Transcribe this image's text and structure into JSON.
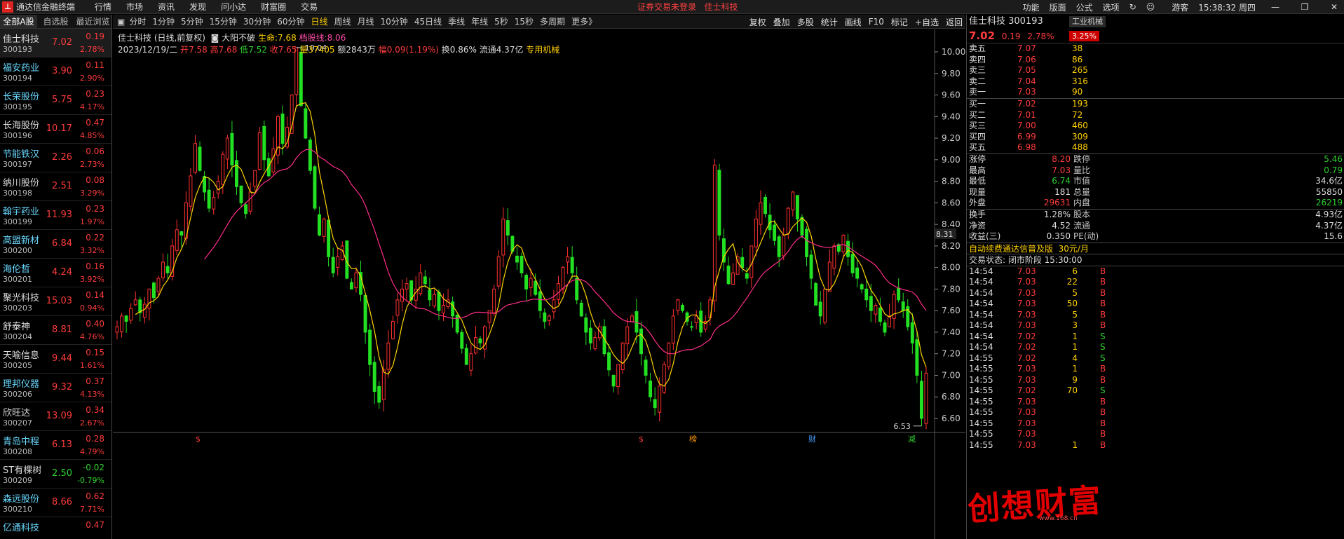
{
  "app": {
    "title": "通达信金融终端",
    "menus": [
      "行情",
      "市场",
      "资讯",
      "发现",
      "问小达",
      "财富圈",
      "交易"
    ],
    "notice": "证券交易未登录",
    "notice_stock": "佳士科技",
    "right_menus": [
      "功能",
      "版面",
      "公式",
      "选项"
    ],
    "user": "游客",
    "clock": "15:38:32 周四"
  },
  "list": {
    "tabs": [
      "全部A股",
      "自选股",
      "最近浏览"
    ],
    "rows": [
      {
        "name": "佳士科技",
        "code": "300193",
        "price": "7.02",
        "chg": "0.19",
        "pct": "2.78%",
        "nc": "w",
        "dir": "up",
        "sel": true
      },
      {
        "name": "福安药业",
        "code": "300194",
        "price": "3.90",
        "chg": "0.11",
        "pct": "2.90%",
        "nc": "c",
        "dir": "up"
      },
      {
        "name": "长荣股份",
        "code": "300195",
        "price": "5.75",
        "chg": "0.23",
        "pct": "4.17%",
        "nc": "c",
        "dir": "up"
      },
      {
        "name": "长海股份",
        "code": "300196",
        "price": "10.17",
        "chg": "0.47",
        "pct": "4.85%",
        "nc": "w",
        "dir": "up"
      },
      {
        "name": "节能铁汉",
        "code": "300197",
        "price": "2.26",
        "chg": "0.06",
        "pct": "2.73%",
        "nc": "c",
        "dir": "up"
      },
      {
        "name": "纳川股份",
        "code": "300198",
        "price": "2.51",
        "chg": "0.08",
        "pct": "3.29%",
        "nc": "w",
        "dir": "up"
      },
      {
        "name": "翰宇药业",
        "code": "300199",
        "price": "11.93",
        "chg": "0.23",
        "pct": "1.97%",
        "nc": "c",
        "dir": "up"
      },
      {
        "name": "高盟新材",
        "code": "300200",
        "price": "6.84",
        "chg": "0.22",
        "pct": "3.32%",
        "nc": "c",
        "dir": "up"
      },
      {
        "name": "海伦哲",
        "code": "300201",
        "price": "4.24",
        "chg": "0.16",
        "pct": "3.92%",
        "nc": "c",
        "dir": "up"
      },
      {
        "name": "聚光科技",
        "code": "300203",
        "price": "15.03",
        "chg": "0.14",
        "pct": "0.94%",
        "nc": "w",
        "dir": "up"
      },
      {
        "name": "舒泰神",
        "code": "300204",
        "price": "8.81",
        "chg": "0.40",
        "pct": "4.76%",
        "nc": "w",
        "dir": "up"
      },
      {
        "name": "天喻信息",
        "code": "300205",
        "price": "9.44",
        "chg": "0.15",
        "pct": "1.61%",
        "nc": "w",
        "dir": "up"
      },
      {
        "name": "理邦仪器",
        "code": "300206",
        "price": "9.32",
        "chg": "0.37",
        "pct": "4.13%",
        "nc": "c",
        "dir": "up"
      },
      {
        "name": "欣旺达",
        "code": "300207",
        "price": "13.09",
        "chg": "0.34",
        "pct": "2.67%",
        "nc": "w",
        "dir": "up"
      },
      {
        "name": "青岛中程",
        "code": "300208",
        "price": "6.13",
        "chg": "0.28",
        "pct": "4.79%",
        "nc": "c",
        "dir": "up"
      },
      {
        "name": "ST有棵树",
        "code": "300209",
        "price": "2.50",
        "chg": "-0.02",
        "pct": "-0.79%",
        "nc": "w",
        "dir": "down"
      },
      {
        "name": "森远股份",
        "code": "300210",
        "price": "8.66",
        "chg": "0.62",
        "pct": "7.71%",
        "nc": "c",
        "dir": "up"
      },
      {
        "name": "亿通科技",
        "code": "",
        "price": "",
        "chg": "0.47",
        "pct": "",
        "nc": "c",
        "dir": "up"
      }
    ]
  },
  "periods": {
    "items": [
      "分时",
      "1分钟",
      "5分钟",
      "15分钟",
      "30分钟",
      "60分钟",
      "日线",
      "周线",
      "月线",
      "10分钟",
      "45日线",
      "季线",
      "年线",
      "5秒",
      "15秒",
      "多周期",
      "更多》"
    ],
    "active": "日线",
    "tools": [
      "复权",
      "叠加",
      "多股",
      "统计",
      "画线",
      "F10",
      "标记",
      "+自选",
      "返回"
    ]
  },
  "chart": {
    "title": "佳士科技 (日线,前复权)",
    "pattern": "大阳不破",
    "life_label": "生命:",
    "life_val": "7.68",
    "line_label": "档股线:",
    "line_val": "8.06",
    "date": "2023/12/19/二",
    "open_l": "开",
    "open": "7.58",
    "high_l": "高",
    "high": "7.68",
    "low_l": "低",
    "low": "7.52",
    "close_l": "收",
    "close": "7.65",
    "vol_l": "量",
    "vol": "37405",
    "amt_l": "额",
    "amt": "2843万",
    "amp_l": "幅",
    "amp": "0.09(1.19%)",
    "turn": "换0.86%",
    "float": "流通4.37亿",
    "sector": "专用机械",
    "max_label": "10.04",
    "min_label": "6.53",
    "cursor_price": "8.31",
    "y_ticks": [
      "10.00",
      "9.80",
      "9.60",
      "9.40",
      "9.20",
      "9.00",
      "8.80",
      "8.60",
      "8.40",
      "8.20",
      "8.00",
      "7.80",
      "7.60",
      "7.40",
      "7.20",
      "7.00",
      "6.80",
      "6.60"
    ],
    "markers": [
      {
        "t": "$",
        "c": "#ff3c3c"
      },
      {
        "t": "$",
        "c": "#ff3c3c"
      },
      {
        "t": "榜",
        "c": "#ff9a00"
      },
      {
        "t": "财",
        "c": "#4aa0ff"
      },
      {
        "t": "减",
        "c": "#2fd12f"
      }
    ]
  },
  "chart_data": {
    "type": "candlestick",
    "title": "佳士科技 (日线,前复权)",
    "ylim": [
      6.5,
      10.1
    ],
    "y_ticks": [
      10.0,
      9.8,
      9.6,
      9.4,
      9.2,
      9.0,
      8.8,
      8.6,
      8.4,
      8.2,
      8.0,
      7.8,
      7.6,
      7.4,
      7.2,
      7.0,
      6.8,
      6.6
    ],
    "high_mark": 10.04,
    "low_mark": 6.53,
    "last_close": 7.02,
    "close_series": [
      7.45,
      7.55,
      7.5,
      7.62,
      7.7,
      7.58,
      7.66,
      7.8,
      7.72,
      7.9,
      8.05,
      7.95,
      8.2,
      8.35,
      8.3,
      8.6,
      8.85,
      9.15,
      8.9,
      8.7,
      8.55,
      8.65,
      8.8,
      9.05,
      9.2,
      8.95,
      8.75,
      8.6,
      8.5,
      8.7,
      8.9,
      9.25,
      9.0,
      8.85,
      9.1,
      9.4,
      9.15,
      9.3,
      9.6,
      10.04,
      9.5,
      9.2,
      8.9,
      8.55,
      8.3,
      8.45,
      8.1,
      7.95,
      8.1,
      8.2,
      7.9,
      7.8,
      7.95,
      7.75,
      7.4,
      7.1,
      6.85,
      6.75,
      7.05,
      7.3,
      7.5,
      7.7,
      7.8,
      7.85,
      7.7,
      7.8,
      7.95,
      7.85,
      7.7,
      7.75,
      7.6,
      7.65,
      7.7,
      7.55,
      7.4,
      7.25,
      7.1,
      7.2,
      7.35,
      7.3,
      7.45,
      7.6,
      7.8,
      8.1,
      8.45,
      8.3,
      8.15,
      8.05,
      7.95,
      7.8,
      7.9,
      7.75,
      7.6,
      7.5,
      7.55,
      7.7,
      7.85,
      8.0,
      8.1,
      7.95,
      7.7,
      7.55,
      7.4,
      7.3,
      7.35,
      7.45,
      7.2,
      7.05,
      6.9,
      7.1,
      7.3,
      7.45,
      7.55,
      7.4,
      7.2,
      7.0,
      6.8,
      6.7,
      6.9,
      7.1,
      7.3,
      7.55,
      7.7,
      7.6,
      7.5,
      7.45,
      7.55,
      7.4,
      7.5,
      7.7,
      8.95,
      8.3,
      8.05,
      7.85,
      7.95,
      8.1,
      8.0,
      7.9,
      8.2,
      8.45,
      8.6,
      8.5,
      8.35,
      8.25,
      8.1,
      8.3,
      8.55,
      8.7,
      8.45,
      8.3,
      8.1,
      7.9,
      7.65,
      7.55,
      7.8,
      8.05,
      8.2,
      8.15,
      8.3,
      8.1,
      7.95,
      7.9,
      7.8,
      7.7,
      7.6,
      7.65,
      7.5,
      7.4,
      7.55,
      7.75,
      7.7,
      7.6,
      7.45,
      7.3,
      7.0,
      6.6,
      7.02
    ]
  },
  "quote": {
    "name_code": "佳士科技 300193",
    "sector": "工业机械",
    "price": "7.02",
    "chg": "0.19",
    "pct": "2.78%",
    "sector_pct": "3.25%",
    "asks": [
      {
        "l": "卖五",
        "p": "7.07",
        "v": "38"
      },
      {
        "l": "卖四",
        "p": "7.06",
        "v": "86"
      },
      {
        "l": "卖三",
        "p": "7.05",
        "v": "265"
      },
      {
        "l": "卖二",
        "p": "7.04",
        "v": "316"
      },
      {
        "l": "卖一",
        "p": "7.03",
        "v": "90"
      }
    ],
    "bids": [
      {
        "l": "买一",
        "p": "7.02",
        "v": "193"
      },
      {
        "l": "买二",
        "p": "7.01",
        "v": "72"
      },
      {
        "l": "买三",
        "p": "7.00",
        "v": "460"
      },
      {
        "l": "买四",
        "p": "6.99",
        "v": "309"
      },
      {
        "l": "买五",
        "p": "6.98",
        "v": "488"
      }
    ],
    "stats1": [
      {
        "a": "涨停",
        "b": "8.20",
        "bc": "red",
        "c": "跌停",
        "d": "5.46",
        "dc": "grn"
      },
      {
        "a": "最高",
        "b": "7.03",
        "bc": "red",
        "c": "量比",
        "d": "0.79",
        "dc": "grn"
      },
      {
        "a": "最低",
        "b": "6.74",
        "bc": "grn",
        "c": "市值",
        "d": "34.6亿",
        "dc": "wht"
      },
      {
        "a": "现量",
        "b": "181",
        "bc": "wht",
        "c": "总量",
        "d": "55850",
        "dc": "wht"
      },
      {
        "a": "外盘",
        "b": "29631",
        "bc": "red",
        "c": "内盘",
        "d": "26219",
        "dc": "grn"
      }
    ],
    "stats2": [
      {
        "a": "换手",
        "b": "1.28%",
        "bc": "wht",
        "c": "股本",
        "d": "4.93亿",
        "dc": "wht"
      },
      {
        "a": "净资",
        "b": "4.52",
        "bc": "wht",
        "c": "流通",
        "d": "4.37亿",
        "dc": "wht"
      },
      {
        "a": "收益(三)",
        "b": "0.350",
        "bc": "wht",
        "c": "PE(动)",
        "d": "15.6",
        "dc": "wht"
      }
    ],
    "banner": "自动续费通达信普及版",
    "banner_price": "30元/月",
    "trade_status": "交易状态: 闭市阶段 15:30:00",
    "trades": [
      {
        "t": "14:54",
        "p": "7.03",
        "v": "6",
        "s": "B"
      },
      {
        "t": "14:54",
        "p": "7.03",
        "v": "22",
        "s": "B"
      },
      {
        "t": "14:54",
        "p": "7.03",
        "v": "5",
        "s": "B"
      },
      {
        "t": "14:54",
        "p": "7.03",
        "v": "50",
        "s": "B"
      },
      {
        "t": "14:54",
        "p": "7.03",
        "v": "5",
        "s": "B"
      },
      {
        "t": "14:54",
        "p": "7.03",
        "v": "3",
        "s": "B"
      },
      {
        "t": "14:54",
        "p": "7.02",
        "v": "1",
        "s": "S"
      },
      {
        "t": "14:54",
        "p": "7.02",
        "v": "1",
        "s": "S"
      },
      {
        "t": "14:55",
        "p": "7.02",
        "v": "4",
        "s": "S"
      },
      {
        "t": "14:55",
        "p": "7.03",
        "v": "1",
        "s": "B"
      },
      {
        "t": "14:55",
        "p": "7.03",
        "v": "9",
        "s": "B"
      },
      {
        "t": "14:55",
        "p": "7.02",
        "v": "70",
        "s": "S"
      },
      {
        "t": "14:55",
        "p": "7.03",
        "v": "",
        "s": "B"
      },
      {
        "t": "14:55",
        "p": "7.03",
        "v": "",
        "s": "B"
      },
      {
        "t": "14:55",
        "p": "7.03",
        "v": "",
        "s": "B"
      },
      {
        "t": "14:55",
        "p": "7.03",
        "v": "",
        "s": "B"
      },
      {
        "t": "14:55",
        "p": "7.03",
        "v": "1",
        "s": "B"
      }
    ],
    "watermark": "创想财富",
    "watermark_site": "www.168.cn"
  }
}
